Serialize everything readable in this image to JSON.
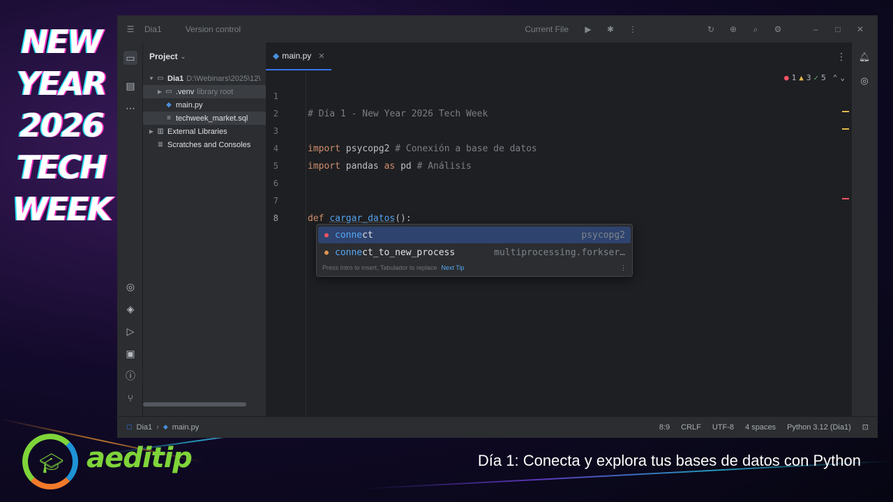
{
  "brand": {
    "title_lines": [
      "NEW",
      "YEAR",
      "2026",
      "TECH",
      "WEEK"
    ],
    "logo_text": "aeditip",
    "subtitle": "Día 1: Conecta y explora tus bases de datos con Python"
  },
  "titlebar": {
    "project": "Dia1",
    "vcs": "Version control",
    "run_config": "Current File"
  },
  "project_panel": {
    "header": "Project",
    "tree": [
      {
        "label": "Dia1",
        "hint": "D:\\Webinars\\2025\\12\\",
        "icon": "folder-icon"
      },
      {
        "label": ".venv",
        "hint": "library root",
        "icon": "folder-icon"
      },
      {
        "label": "main.py",
        "hint": "",
        "icon": "python-file-icon"
      },
      {
        "label": "techweek_market.sql",
        "hint": "",
        "icon": "sql-file-icon"
      },
      {
        "label": "External Libraries",
        "hint": "",
        "icon": "library-icon"
      },
      {
        "label": "Scratches and Consoles",
        "hint": "",
        "icon": "scratches-icon"
      }
    ]
  },
  "editor": {
    "tab": "main.py",
    "inspections": {
      "errors": "1",
      "warnings": "3",
      "ok": "5"
    },
    "lines": [
      {
        "n": "1",
        "comment": "# Día 1 - New Year 2026 Tech Week"
      },
      {
        "n": "2"
      },
      {
        "n": "3",
        "kw": "import",
        "mod": " psycopg2 ",
        "comment": "# Conexión a base de datos"
      },
      {
        "n": "4",
        "kw": "import",
        "mod": " pandas ",
        "kw2": "as",
        "alias": " pd ",
        "comment": "# Análisis"
      },
      {
        "n": "5"
      },
      {
        "n": "6"
      },
      {
        "n": "7",
        "kw": "def",
        "func": "cargar_datos",
        "tail": "():"
      },
      {
        "n": "8",
        "typed": "conne"
      }
    ]
  },
  "completion": {
    "items": [
      {
        "match": "conne",
        "rest": "ct",
        "source": "psycopg2"
      },
      {
        "match": "conne",
        "rest": "ct_to_new_process",
        "source": "multiprocessing.forkser…"
      }
    ],
    "footer_hint": "Press Intro to insert, Tabulador to replace",
    "footer_link": "Next Tip"
  },
  "statusbar": {
    "breadcrumb_project": "Dia1",
    "breadcrumb_file": "main.py",
    "position": "8:9",
    "line_sep": "CRLF",
    "encoding": "UTF-8",
    "indent": "4 spaces",
    "interpreter": "Python 3.12 (Dia1)"
  },
  "colors": {
    "accent": "#3574f0",
    "logo_green": "#7fd43a",
    "error": "#f75464",
    "warning": "#e0b94f"
  }
}
